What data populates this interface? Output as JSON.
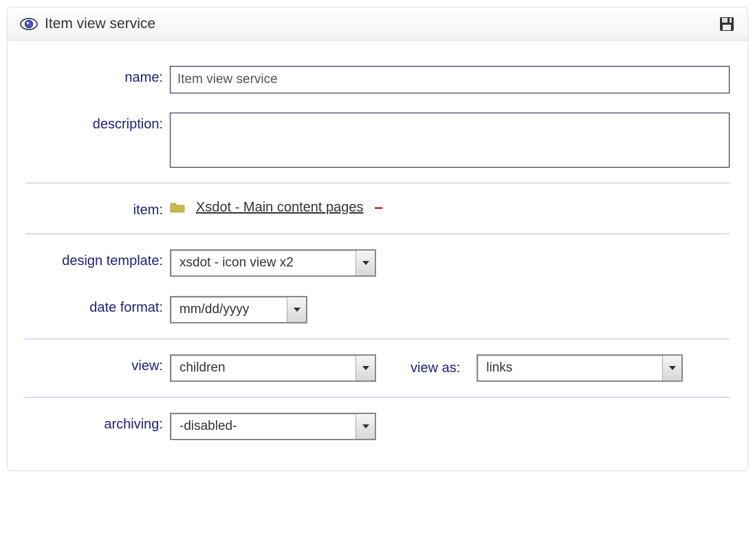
{
  "header": {
    "title": "Item view service"
  },
  "labels": {
    "name": "name:",
    "description": "description:",
    "item": "item:",
    "design_template": "design template:",
    "date_format": "date format:",
    "view": "view:",
    "view_as": "view as:",
    "archiving": "archiving:"
  },
  "fields": {
    "name_value": "Item view service",
    "description_value": "",
    "item_link": "Xsdot - Main content pages",
    "remove_item": "–",
    "design_template_value": "xsdot - icon view x2",
    "date_format_value": "mm/dd/yyyy",
    "view_value": "children",
    "view_as_value": "links",
    "archiving_value": "-disabled-"
  }
}
